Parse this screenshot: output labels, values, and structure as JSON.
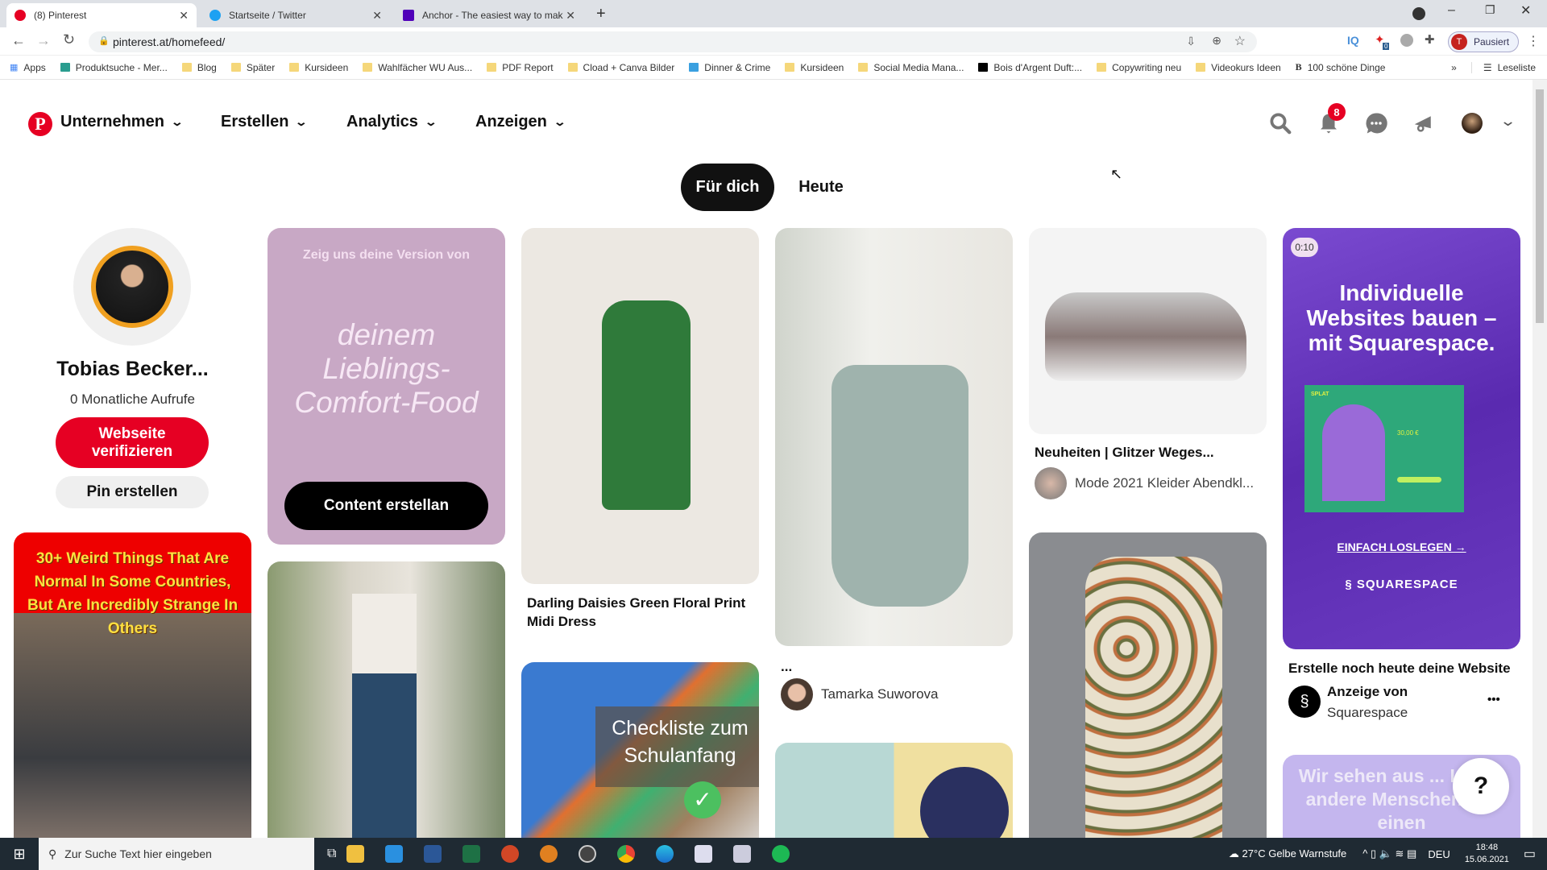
{
  "browser": {
    "tabs": [
      {
        "title": "(8) Pinterest",
        "color": "#e60023"
      },
      {
        "title": "Startseite / Twitter",
        "color": "#1da1f2"
      },
      {
        "title": "Anchor - The easiest way to mak",
        "color": "#5000b9"
      }
    ],
    "new_tab": "+",
    "url": "pinterest.at/homefeed/",
    "profile_initial": "T",
    "profile_status": "Pausiert",
    "ext_badge": "0",
    "ext_iq": "IQ",
    "bookmarks": [
      "Apps",
      "Produktsuche - Mer...",
      "Blog",
      "Später",
      "Kursideen",
      "Wahlfächer WU Aus...",
      "PDF Report",
      "Cload + Canva Bilder",
      "Dinner & Crime",
      "Kursideen",
      "Social Media Mana...",
      "Bois d'Argent Duft:...",
      "Copywriting neu",
      "Videokurs Ideen",
      "100 schöne Dinge"
    ],
    "more": "»",
    "reading_list": "Leseliste"
  },
  "header": {
    "nav": [
      "Unternehmen",
      "Erstellen",
      "Analytics",
      "Anzeigen"
    ],
    "notification_count": "8",
    "brand_color": "#e60023"
  },
  "feed_tabs": [
    "Für dich",
    "Heute"
  ],
  "profile": {
    "name": "Tobias Becker...",
    "views": "0 Monatliche Aufrufe",
    "verify": "Webseite verifizieren",
    "create_pin": "Pin erstellen"
  },
  "pins": {
    "weird": "30+ Weird Things That Are Normal In Some Countries, But Are Incredibly Strange In Others",
    "comfort": {
      "top": "Zeig uns deine Version von",
      "main": "deinem Lieblings-Comfort-Food",
      "button": "Content erstellan"
    },
    "dress": {
      "title": "Darling Daisies Green Floral Print Midi Dress"
    },
    "checklist": "Checkliste zum Schulanfang",
    "sundress": {
      "title": "...",
      "author": "Tamarka Suworova"
    },
    "shoes": {
      "title": "Neuheiten | Glitzer Weges...",
      "author": "Mode 2021 Kleider Abendkl..."
    },
    "ad": {
      "duration": "0:10",
      "headline": "Individuelle Websites bauen – mit Squarespace.",
      "mock_brand": "SPLAT",
      "mock_price": "30,00 €",
      "cta": "EINFACH LOSLEGEN →",
      "brand": "SQUARESPACE",
      "title": "Erstelle noch heute deine Website",
      "sponsor_label": "Anzeige von",
      "sponsor": "Squarespace",
      "more": "•••"
    },
    "lavender": "Wir sehen aus ... Leben andere Menschen nur einen"
  },
  "help": "?",
  "taskbar": {
    "search": "Zur Suche Text hier eingeben",
    "weather": "27°C  Gelbe Warnstufe",
    "lang": "DEU",
    "time": "18:48",
    "date": "15.06.2021"
  }
}
